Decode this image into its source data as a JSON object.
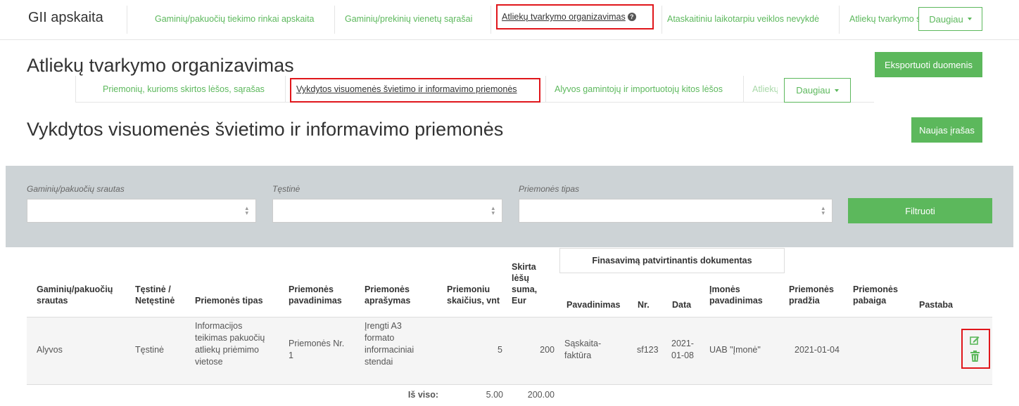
{
  "app": {
    "brand": "GII apskaita"
  },
  "topnav": {
    "tabs": [
      "Gaminių/pakuočių tiekimo rinkai apskaita",
      "Gaminių/prekinių vienetų sąrašai",
      "Atliekų tvarkymo organizavimas",
      "Ataskaitiniu laikotarpiu veiklos nevykdė",
      "Atliekų tvarkymo s"
    ],
    "more_label": "Daugiau"
  },
  "section": {
    "title": "Atliekų tvarkymo organizavimas",
    "export_label": "Eksportuoti duomenis",
    "subtabs": [
      "Priemonių, kurioms skirtos lėšos, sąrašas",
      "Vykdytos visuomenės švietimo ir informavimo priemonės",
      "Alyvos gamintojų ir importuotojų kitos lėšos",
      "Atliekų"
    ],
    "more_label": "Daugiau"
  },
  "page": {
    "title": "Vykdytos visuomenės švietimo ir informavimo priemonės",
    "new_label": "Naujas įrašas"
  },
  "filters": {
    "flow_label": "Gaminių/pakuočių srautas",
    "cont_label": "Tęstinė",
    "type_label": "Priemonės tipas",
    "flow_value": "",
    "cont_value": "",
    "type_value": "",
    "filter_label": "Filtruoti"
  },
  "table": {
    "group_header": "Finasavimą patvirtinantis dokumentas",
    "headers": {
      "flow": [
        "Gaminių/pakuočių",
        "srautas"
      ],
      "cont": [
        "Tęstinė /",
        "Netęstinė"
      ],
      "type": "Priemonės tipas",
      "name": [
        "Priemonės",
        "pavadinimas"
      ],
      "desc": [
        "Priemonės",
        "aprašymas"
      ],
      "count": [
        "Priemoniu",
        "skaičius, vnt"
      ],
      "sum": [
        "Skirta",
        "lėšų",
        "suma,",
        "Eur"
      ],
      "doc_name": "Pavadinimas",
      "doc_nr": "Nr.",
      "doc_date": "Data",
      "company": [
        "Įmonės",
        "pavadinimas"
      ],
      "start": [
        "Priemonės",
        "pradžia"
      ],
      "end": [
        "Priemonės",
        "pabaiga"
      ],
      "note": "Pastaba"
    },
    "row": {
      "flow": "Alyvos",
      "cont": "Tęstinė",
      "type": [
        "Informacijos",
        "teikimas pakuočių",
        "atliekų priėmimo",
        "vietose"
      ],
      "name": [
        "Priemonės Nr.",
        "1"
      ],
      "desc": [
        "Įrengti A3",
        "formato",
        "informaciniai",
        "stendai"
      ],
      "count": "5",
      "sum": "200",
      "doc_name": [
        "Sąskaita-",
        "faktūra"
      ],
      "doc_nr": "sf123",
      "doc_date": [
        "2021-",
        "01-08"
      ],
      "company": "UAB \"Įmonė\"",
      "start": "2021-01-04",
      "end": "",
      "note": ""
    },
    "totals": {
      "label": "Iš viso:",
      "count": "5.00",
      "sum": "200.00"
    }
  },
  "icons": {
    "edit": "edit-icon",
    "delete": "trash-icon",
    "help": "help-icon",
    "accent": "#5cb85c",
    "highlight": "#e0161b"
  }
}
